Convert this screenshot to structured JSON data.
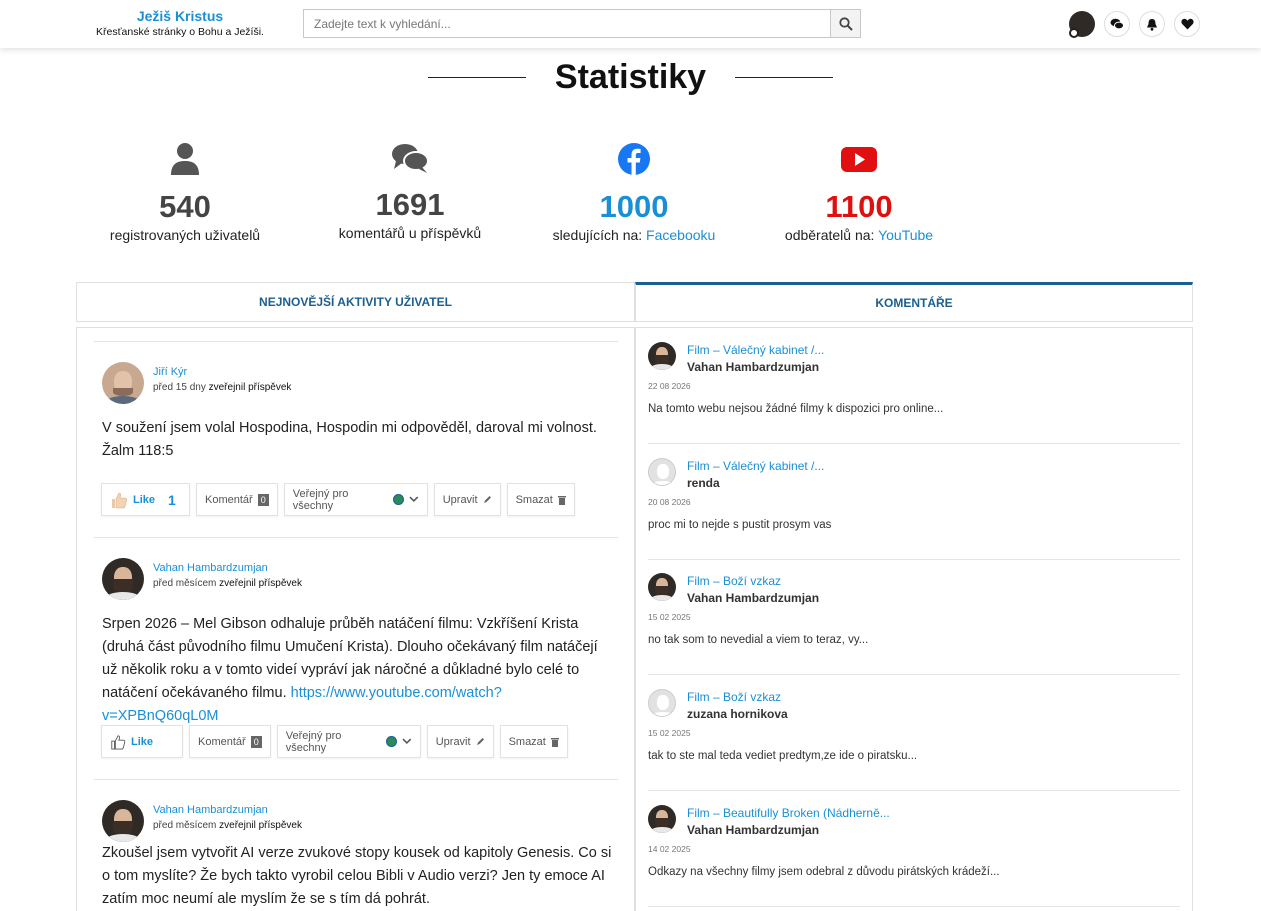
{
  "header": {
    "brand_title": "Ježiš Kristus",
    "brand_subtitle": "Křesťanské stránky o Bohu a Ježíši.",
    "search_placeholder": "Zadejte text k vyhledání..."
  },
  "stats": {
    "heading": "Statistiky",
    "items": [
      {
        "value": "540",
        "label": "registrovaných uživatelů",
        "link": "",
        "color": "#444444",
        "icon": "user-icon"
      },
      {
        "value": "1691",
        "label": "komentářů u příspěvků",
        "link": "",
        "color": "#444444",
        "icon": "comments-icon"
      },
      {
        "value": "1000",
        "label": "sledujících na:",
        "link": "Facebooku",
        "color": "#1a8fd6",
        "icon": "facebook-icon"
      },
      {
        "value": "1100",
        "label": "odběratelů na:",
        "link": "YouTube",
        "color": "#e01010",
        "icon": "youtube-icon"
      }
    ]
  },
  "tabs": {
    "activity": "NEJNOVĚJŠÍ AKTIVITY UŽIVATEL",
    "comments": "KOMENTÁŘE"
  },
  "posts": [
    {
      "author": "Jiří Kýr",
      "time": "před 15 dny",
      "action": "zveřejnil příspěvek",
      "text": "V soužení jsem volal Hospodina, Hospodin mi odpověděl, daroval mi volnost. Žalm 118:5",
      "link": "",
      "like_label": "Like",
      "like_count": "1",
      "comment_label": "Komentář",
      "comment_count": "0",
      "visibility": "Veřejný pro všechny",
      "edit_label": "Upravit",
      "delete_label": "Smazat"
    },
    {
      "author": "Vahan Hambardzumjan",
      "time": "před měsícem",
      "action": "zveřejnil příspěvek",
      "text": "Srpen 2026 – Mel Gibson odhaluje průběh natáčení filmu: Vzkříšení Krista (druhá část původního filmu Umučení Krista). Dlouho očekávaný film natáčejí už několik roku a v tomto videí vypráví jak náročné a důkladné bylo celé to natáčení očekávaného filmu.",
      "link": "https://www.youtube.com/watch?v=XPBnQ60qL0M",
      "like_label": "Like",
      "like_count": "",
      "comment_label": "Komentář",
      "comment_count": "0",
      "visibility": "Veřejný pro všechny",
      "edit_label": "Upravit",
      "delete_label": "Smazat"
    },
    {
      "author": "Vahan Hambardzumjan",
      "time": "před měsícem",
      "action": "zveřejnil příspěvek",
      "text": "Zkoušel jsem vytvořit AI verze zvukové stopy kousek od kapitoly Genesis. Co si o tom myslíte? Že bych takto vyrobil celou Bibli v Audio verzi? Jen ty emoce AI zatím moc neumí ale myslím že se s tím dá pohrát."
    }
  ],
  "comments": [
    {
      "title": "Film – Válečný kabinet /...",
      "author": "Vahan Hambardzumjan",
      "date": "22 08 2026",
      "text": "Na tomto webu nejsou žádné filmy k dispozici pro online...",
      "avatar": "photo"
    },
    {
      "title": "Film – Válečný kabinet /...",
      "author": "renda",
      "date": "20 08 2026",
      "text": "proc mi to nejde s pustit prosym vas",
      "avatar": "default"
    },
    {
      "title": "Film – Boží vzkaz",
      "author": "Vahan Hambardzumjan",
      "date": "15 02 2025",
      "text": "no tak som to nevedial a viem to teraz, vy...",
      "avatar": "photo"
    },
    {
      "title": "Film – Boží vzkaz",
      "author": "zuzana hornikova",
      "date": "15 02 2025",
      "text": "tak to ste mal teda vediet predtym,ze ide o piratsku...",
      "avatar": "default"
    },
    {
      "title": "Film – Beautifully Broken (Nádherně...",
      "author": "Vahan Hambardzumjan",
      "date": "14 02 2025",
      "text": "Odkazy na všechny filmy jsem odebral z důvodu pirátských krádeží...",
      "avatar": "photo"
    }
  ]
}
